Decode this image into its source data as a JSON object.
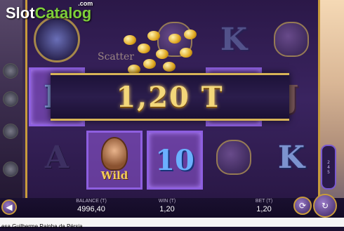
{
  "logo": {
    "part1": "Slot",
    "part2": "Catalog",
    "suffix": ".com"
  },
  "win_banner": {
    "amount": "1,20 T"
  },
  "symbols": {
    "reel1": [
      "K",
      "A"
    ],
    "reel2": [
      "A"
    ],
    "reel3": [
      "10"
    ],
    "reel4": [
      "J"
    ],
    "reel5": [
      "K",
      "J",
      "K"
    ]
  },
  "scatter_label": "Scatter",
  "wild_label": "Wild",
  "lines_indicator": [
    "2",
    "4",
    "5"
  ],
  "footer": {
    "balance_label": "BALANCE (T)",
    "balance_value": "4996,40",
    "win_label": "WIN (T)",
    "win_value": "1,20",
    "bet_label": "BET (T)",
    "bet_value": "1,20"
  },
  "caption": "esa Guilherme Rainha da Pérsia",
  "colors": {
    "gold": "#f3d77a",
    "highlight": "#8e5fe0",
    "brand_green": "#7ecf3a"
  }
}
